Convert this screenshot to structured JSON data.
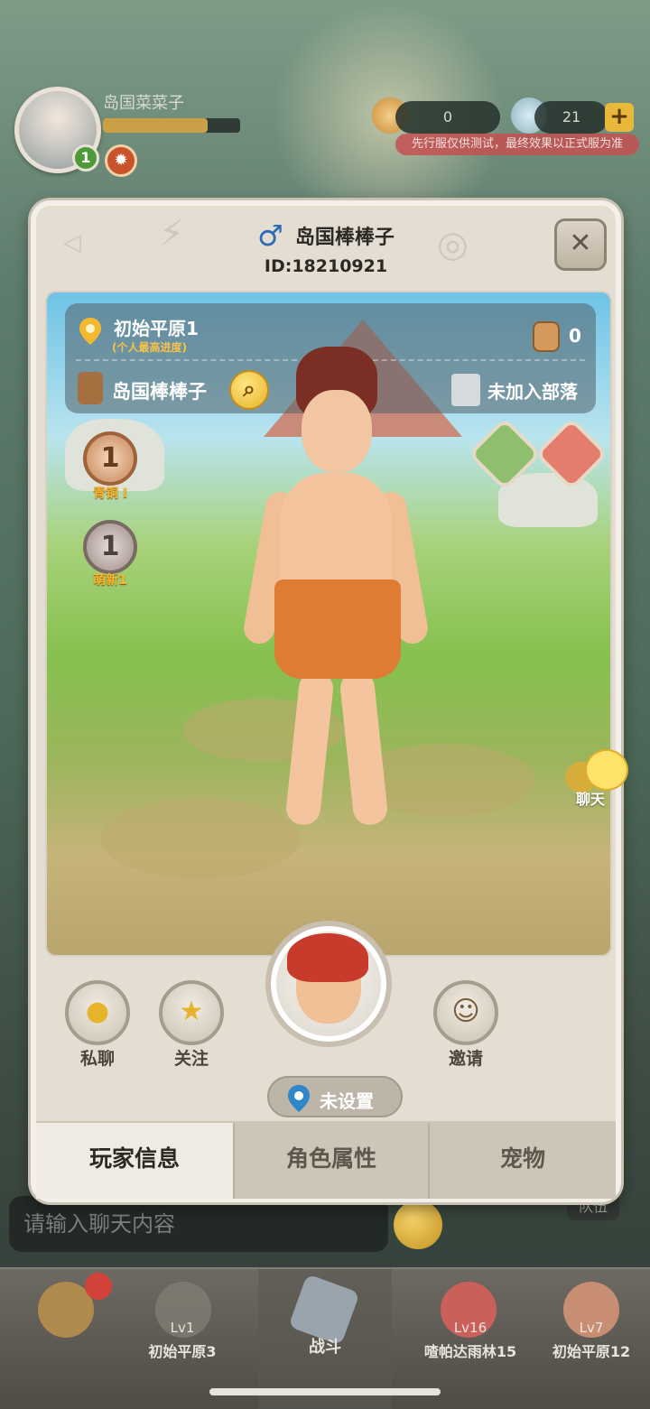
{
  "hud": {
    "username": "岛国菜菜子",
    "level": "1",
    "currency1": "0",
    "currency2": "21",
    "test_notice": "先行服仅供测试，最终效果以正式服为准",
    "chat_placeholder": "请输入聊天内容",
    "team_label": "队伍",
    "side_chat_label": "聊天"
  },
  "profile": {
    "name": "岛国棒棒子",
    "id": "ID:18210921",
    "location": "初始平原1",
    "location_note": "(个人最高进度)",
    "fans_count": "0",
    "character_name": "岛国棒棒子",
    "tribe": "未加入部落",
    "rank1": {
      "number": "1",
      "label": "青铜 I"
    },
    "rank2": {
      "number": "1",
      "label": "萌新1"
    },
    "location_setting": "未设置"
  },
  "actions": {
    "private_chat": "私聊",
    "follow": "关注",
    "invite": "邀请"
  },
  "tabs": [
    {
      "label": "玩家信息",
      "active": true
    },
    {
      "label": "角色属性",
      "active": false
    },
    {
      "label": "宠物",
      "active": false
    }
  ],
  "bottom_nav": [
    {
      "lv": "",
      "label": ""
    },
    {
      "lv": "Lv1",
      "label": "初始平原3"
    },
    {
      "lv": "",
      "label": "战斗"
    },
    {
      "lv": "Lv16",
      "label": "喳帕达雨林15"
    },
    {
      "lv": "Lv7",
      "label": "初始平原12"
    }
  ],
  "colors": {
    "modal_bg": "#e3ddd2",
    "accent_gold": "#e6b32a",
    "male_blue": "#2c6bb7"
  }
}
